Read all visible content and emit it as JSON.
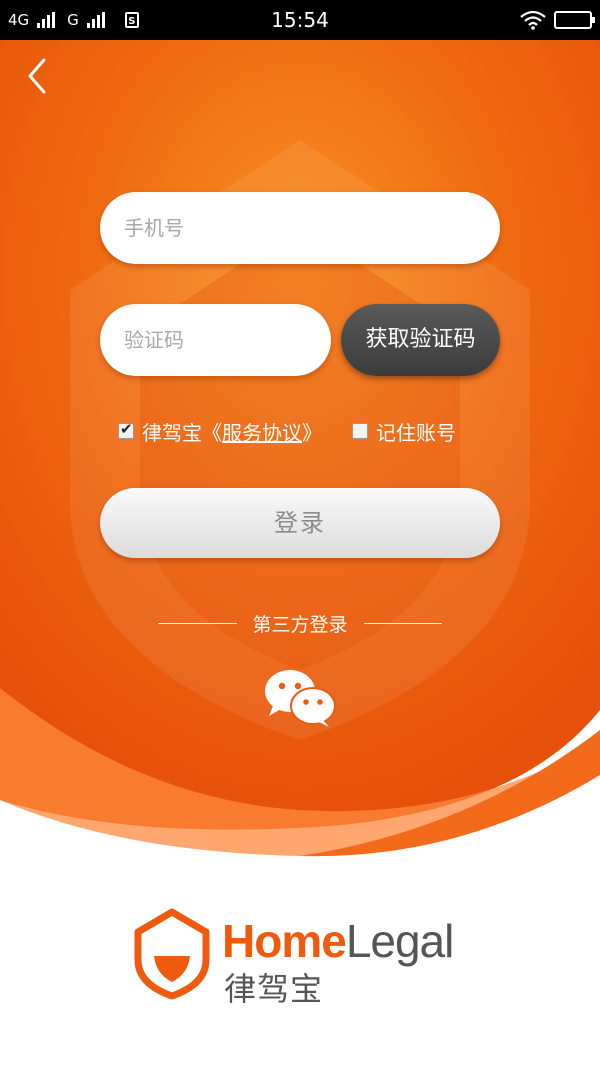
{
  "status_bar": {
    "network_1": "4G",
    "network_2": "G",
    "sim_label": "S",
    "time": "15:54"
  },
  "form": {
    "phone_placeholder": "手机号",
    "code_placeholder": "验证码",
    "get_code_label": "获取验证码",
    "agree_prefix": "律驾宝《",
    "agree_link": "服务协议",
    "agree_suffix": "》",
    "agree_checked": true,
    "remember_label": "记住账号",
    "remember_checked": false,
    "login_label": "登录"
  },
  "third_party": {
    "label": "第三方登录",
    "icon": "wechat-icon"
  },
  "brand": {
    "name_part1": "Home",
    "name_part2": "Legal",
    "name_cn": "律驾宝"
  },
  "colors": {
    "primary_orange": "#ef5a0f",
    "dark_button": "#444444",
    "logo_gray": "#555555"
  }
}
